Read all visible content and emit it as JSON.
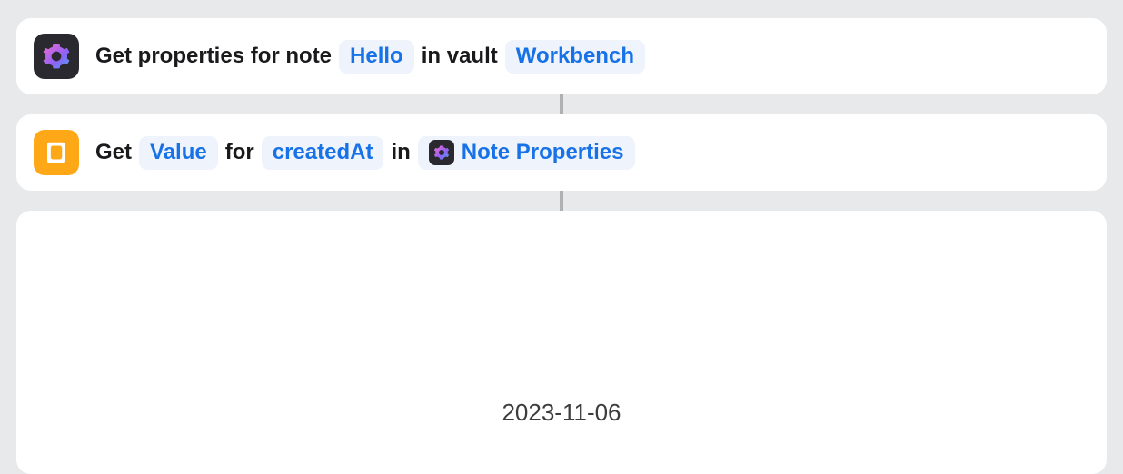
{
  "step1": {
    "text_a": "Get properties for note",
    "token_note": "Hello",
    "text_b": "in vault",
    "token_vault": "Workbench"
  },
  "step2": {
    "text_a": "Get",
    "token_what": "Value",
    "text_b": "for",
    "token_key": "createdAt",
    "text_c": "in",
    "token_source": "Note Properties"
  },
  "result": {
    "value": "2023-11-06"
  }
}
